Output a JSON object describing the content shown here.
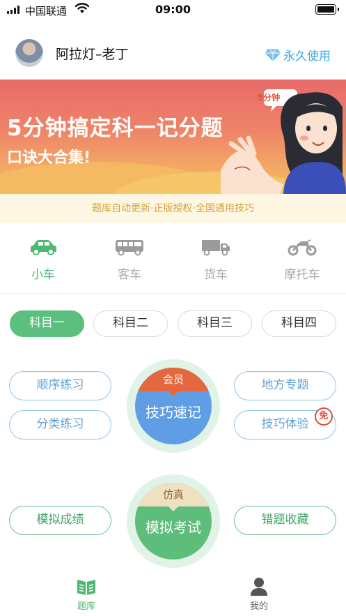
{
  "status_bar": {
    "carrier": "中国联通",
    "time": "09:00"
  },
  "header": {
    "username": "阿拉灯–老丁",
    "vip_label": "永久使用"
  },
  "banner": {
    "title": "5分钟搞定科一记分题",
    "subtitle": "口诀大合集!",
    "tag": "5分钟"
  },
  "notice": "题库自动更新·正版授权·全国通用技巧",
  "vehicle_tabs": [
    {
      "label": "小车",
      "icon": "car-icon",
      "active": true
    },
    {
      "label": "客车",
      "icon": "bus-icon",
      "active": false
    },
    {
      "label": "货车",
      "icon": "truck-icon",
      "active": false
    },
    {
      "label": "摩托车",
      "icon": "motorcycle-icon",
      "active": false
    }
  ],
  "subjects": [
    {
      "label": "科目一",
      "active": true
    },
    {
      "label": "科目二",
      "active": false
    },
    {
      "label": "科目三",
      "active": false
    },
    {
      "label": "科目四",
      "active": false
    }
  ],
  "practice": {
    "sequential": "顺序练习",
    "category": "分类练习",
    "local": "地方专题",
    "tips_trial": "技巧体验",
    "free_badge": "免",
    "mock_score": "模拟成绩",
    "wrong_collection": "错题收藏",
    "tips_circle": {
      "badge": "会员",
      "label": "技巧速记"
    },
    "exam_circle": {
      "badge": "仿真",
      "label": "模拟考试"
    }
  },
  "bottom_nav": [
    {
      "label": "题库",
      "icon": "book-icon",
      "active": true
    },
    {
      "label": "我的",
      "icon": "person-icon",
      "active": false
    }
  ],
  "colors": {
    "green": "#5bbf7e",
    "blue": "#5f9ee4",
    "orange": "#e4673f",
    "vip_blue": "#39a6e3"
  }
}
